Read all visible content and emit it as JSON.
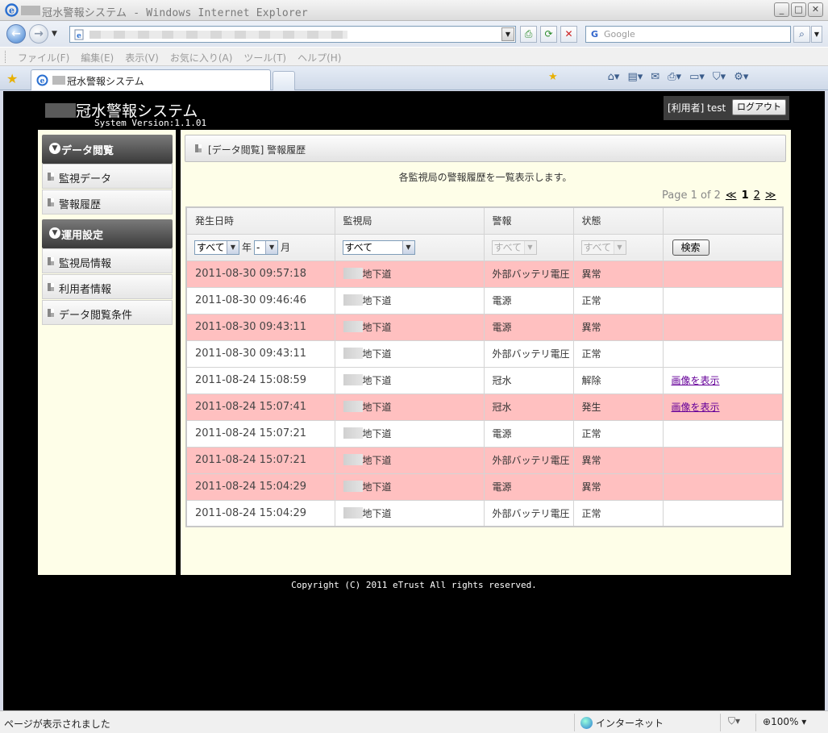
{
  "browser": {
    "window_title": "冠水警報システム - Windows Internet Explorer",
    "search_placeholder": "Google",
    "menu": [
      "ファイル(F)",
      "編集(E)",
      "表示(V)",
      "お気に入り(A)",
      "ツール(T)",
      "ヘルプ(H)"
    ],
    "tab_title": "冠水警報システム",
    "status_message": "ページが表示されました",
    "zone": "インターネット",
    "zoom": "100%"
  },
  "header": {
    "site_title": "冠水警報システム",
    "version": "System Version:1.1.01",
    "user_label": "[利用者] test",
    "logout_label": "ログアウト"
  },
  "sidebar": {
    "sections": [
      {
        "title": "データ閲覧",
        "items": [
          "監視データ",
          "警報履歴"
        ]
      },
      {
        "title": "運用設定",
        "items": [
          "監視局情報",
          "利用者情報",
          "データ閲覧条件"
        ]
      }
    ]
  },
  "main": {
    "panel_title": "[データ閲覧] 警報履歴",
    "description": "各監視局の警報履歴を一覧表示します。",
    "pager": {
      "text": "Page 1 of 2",
      "first": "≪",
      "current": "1",
      "next_page": "2",
      "last": "≫"
    },
    "columns": [
      "発生日時",
      "監視局",
      "警報",
      "状態",
      ""
    ],
    "filters": {
      "year": "すべて",
      "year_suffix": "年",
      "month": "-",
      "month_suffix": "月",
      "station": "すべて",
      "alarm": "すべて",
      "state": "すべて",
      "search_button": "検索"
    },
    "rows": [
      {
        "datetime": "2011-08-30 09:57:18",
        "station": "地下道",
        "alarm": "外部バッテリ電圧",
        "state": "異常",
        "link": "",
        "alert": true
      },
      {
        "datetime": "2011-08-30 09:46:46",
        "station": "地下道",
        "alarm": "電源",
        "state": "正常",
        "link": "",
        "alert": false
      },
      {
        "datetime": "2011-08-30 09:43:11",
        "station": "地下道",
        "alarm": "電源",
        "state": "異常",
        "link": "",
        "alert": true
      },
      {
        "datetime": "2011-08-30 09:43:11",
        "station": "地下道",
        "alarm": "外部バッテリ電圧",
        "state": "正常",
        "link": "",
        "alert": false
      },
      {
        "datetime": "2011-08-24 15:08:59",
        "station": "地下道",
        "alarm": "冠水",
        "state": "解除",
        "link": "画像を表示",
        "alert": false
      },
      {
        "datetime": "2011-08-24 15:07:41",
        "station": "地下道",
        "alarm": "冠水",
        "state": "発生",
        "link": "画像を表示",
        "alert": true
      },
      {
        "datetime": "2011-08-24 15:07:21",
        "station": "地下道",
        "alarm": "電源",
        "state": "正常",
        "link": "",
        "alert": false
      },
      {
        "datetime": "2011-08-24 15:07:21",
        "station": "地下道",
        "alarm": "外部バッテリ電圧",
        "state": "異常",
        "link": "",
        "alert": true
      },
      {
        "datetime": "2011-08-24 15:04:29",
        "station": "地下道",
        "alarm": "電源",
        "state": "異常",
        "link": "",
        "alert": true
      },
      {
        "datetime": "2011-08-24 15:04:29",
        "station": "地下道",
        "alarm": "外部バッテリ電圧",
        "state": "正常",
        "link": "",
        "alert": false
      }
    ]
  },
  "footer": {
    "copyright": "Copyright (C) 2011 eTrust All rights reserved."
  },
  "colors": {
    "alert_row": "#ffc0c0",
    "content_bg": "#fefee8",
    "page_bg": "#000000"
  }
}
